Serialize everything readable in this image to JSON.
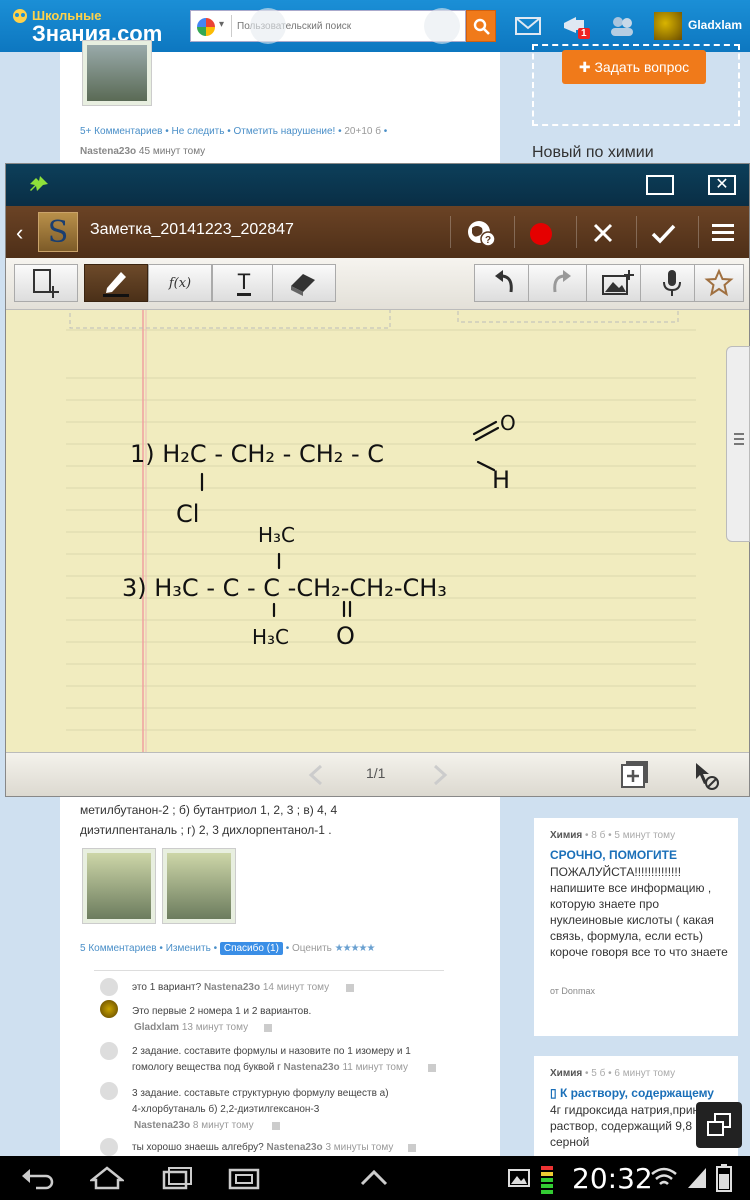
{
  "site": {
    "logo_small": "Школьные",
    "logo_big": "Знания.com",
    "search_placeholder": "Пользовательский поиск",
    "notification_count": "1",
    "username": "Gladxlam",
    "ask_button": "Задать вопрос",
    "sidebar_title": "Новый по химии"
  },
  "top_post": {
    "meta": [
      "5+ Комментариев",
      "Не следить",
      "Отметить нарушение!",
      "20+10 б"
    ],
    "author": "Nastena23o",
    "time": "45 минут тому"
  },
  "snote": {
    "note_title": "Заметка_20141223_202847",
    "page_indicator": "1/1",
    "tool_text_label": "T",
    "tool_fx_label": "f(x)"
  },
  "handwriting": {
    "item1_main": "1) H₂C - CH₂ - CH₂ - C",
    "item1_sub": "Cl",
    "item1_o": "O",
    "item1_h": "H",
    "item2_top": "H₃C",
    "item2_main": "3) H₃C - C - C -CH₂-CH₂-CH₃",
    "item2_bottom": "H₃C",
    "item2_o": "O"
  },
  "question": {
    "text": "метилбутанон-2 ; б) бутантриол 1, 2, 3 ; в) 4, 4 диэтилпентаналь ; г) 2, 3 дихлорпентанол-1 .",
    "comments_label": "5 Комментариев",
    "edit_label": "Изменить",
    "thanks_label": "Спасибо (1)",
    "rate_label": "Оценить",
    "stars": "★★★★★"
  },
  "comments": [
    {
      "text": "это 1 вариант?",
      "author": "Nastena23o",
      "time": "14 минут тому"
    },
    {
      "text": "Это первые 2 номера 1 и 2 вариантов.",
      "author": "Gladxlam",
      "time": "13 минут тому"
    },
    {
      "text": "2 задание. составите формулы и назовите по 1 изомеру и 1",
      "text2": "гомологу вещества под буквой г",
      "author": "Nastena23o",
      "time": "11 минут тому"
    },
    {
      "text": "3 задание. составьте структурную формулу веществ а)",
      "text2": "4-хлорбутаналь б) 2,2-диэтилгексанон-3",
      "author": "Nastena23o",
      "time": "8 минут тому"
    },
    {
      "text": "ты хорошо знаешь алгебру?",
      "author": "Nastena23o",
      "time": "3 минуты тому"
    }
  ],
  "sidebar_cards": [
    {
      "category": "Химия",
      "points": "8 б",
      "time": "5 минут тому",
      "title": "СРОЧНО, ПОМОГИТЕ",
      "body": "ПОЖАЛУЙСТА!!!!!!!!!!!!!! напишите все информацию , которую знаете про нуклеиновые кислоты ( какая связь, формула, если есть) короче говоря все то что знаете",
      "from": "от Donmax"
    },
    {
      "category": "Химия",
      "points": "5 б",
      "time": "6 минут тому",
      "title": "К раствору, содержащему",
      "body": "4г гидроксида натрия,принили раствор, содержащий 9,8 г серной"
    }
  ],
  "status_bar": {
    "clock": "20:32"
  },
  "colors": {
    "site_blue": "#1b8fd6",
    "accent_orange": "#f07a1a",
    "snote_brown": "#5a3820",
    "paper": "#f1ecbf"
  }
}
